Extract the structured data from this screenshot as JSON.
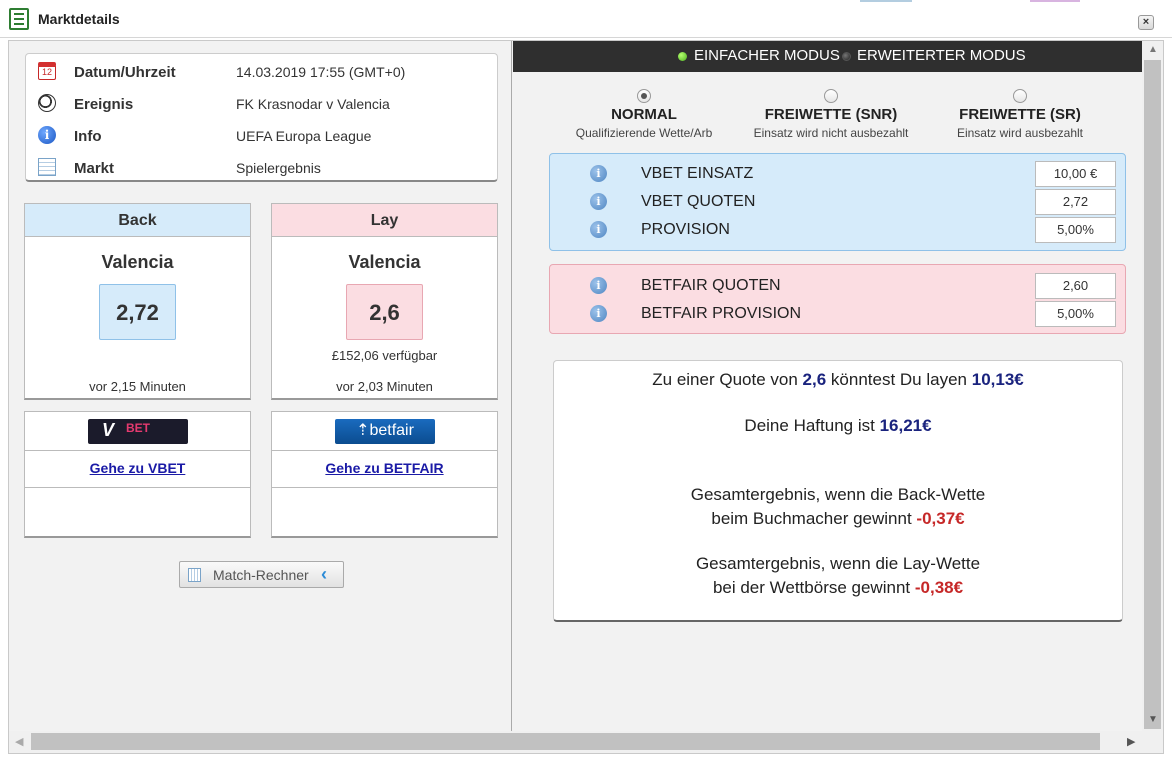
{
  "window": {
    "title": "Marktdetails"
  },
  "info": {
    "rows": [
      {
        "label": "Datum/Uhrzeit",
        "value": "14.03.2019 17:55 (GMT+0)",
        "icon": "calendar-icon"
      },
      {
        "label": "Ereignis",
        "value": "FK Krasnodar v Valencia",
        "icon": "soccer-ball-icon"
      },
      {
        "label": "Info",
        "value": "UEFA Europa League",
        "icon": "info-icon"
      },
      {
        "label": "Markt",
        "value": "Spielergebnis",
        "icon": "table-icon"
      }
    ]
  },
  "back": {
    "header": "Back",
    "team": "Valencia",
    "odds": "2,72",
    "time": "vor 2,15 Minuten"
  },
  "lay": {
    "header": "Lay",
    "team": "Valencia",
    "odds": "2,6",
    "available": "£152,06 verfügbar",
    "time": "vor 2,03 Minuten"
  },
  "links": {
    "vbet": {
      "logo_text": "BET",
      "link": "Gehe zu VBET"
    },
    "betfair": {
      "logo_text": "betfair",
      "link": "Gehe zu BETFAIR"
    }
  },
  "match_button": "Match-Rechner",
  "modes": {
    "simple": "EINFACHER MODUS",
    "advanced": "ERWEITERTER MODUS",
    "active": "simple"
  },
  "bet_types": [
    {
      "title": "NORMAL",
      "sub": "Qualifizierende Wette/Arb",
      "selected": true
    },
    {
      "title": "FREIWETTE (SNR)",
      "sub": "Einsatz wird nicht ausbezahlt",
      "selected": false
    },
    {
      "title": "FREIWETTE (SR)",
      "sub": "Einsatz wird ausbezahlt",
      "selected": false
    }
  ],
  "vbet_fields": [
    {
      "label": "VBET EINSATZ",
      "value": "10,00 €"
    },
    {
      "label": "VBET QUOTEN",
      "value": "2,72"
    },
    {
      "label": "PROVISION",
      "value": "5,00%"
    }
  ],
  "betfair_fields": [
    {
      "label": "BETFAIR QUOTEN",
      "value": "2,60"
    },
    {
      "label": "BETFAIR PROVISION",
      "value": "5,00%"
    }
  ],
  "result": {
    "line1_pre": "Zu einer Quote von",
    "line1_odds": "2,6",
    "line1_mid": "könntest Du layen",
    "line1_amount": "10,13€",
    "line2_pre": "Deine Haftung ist",
    "line2_amount": "16,21€",
    "back_line1": "Gesamtergebnis, wenn die Back-Wette",
    "back_line2": "beim Buchmacher gewinnt",
    "back_amount": "-0,37€",
    "lay_line1": "Gesamtergebnis, wenn die Lay-Wette",
    "lay_line2": "bei der Wettbörse gewinnt",
    "lay_amount": "-0,38€"
  },
  "colors": {
    "back": "#d6ebfa",
    "lay": "#fbdde2",
    "mode_bar": "#2f2f2f",
    "accent_green": "#4caf20",
    "negative": "#c62828",
    "highlight": "#1a237e"
  }
}
